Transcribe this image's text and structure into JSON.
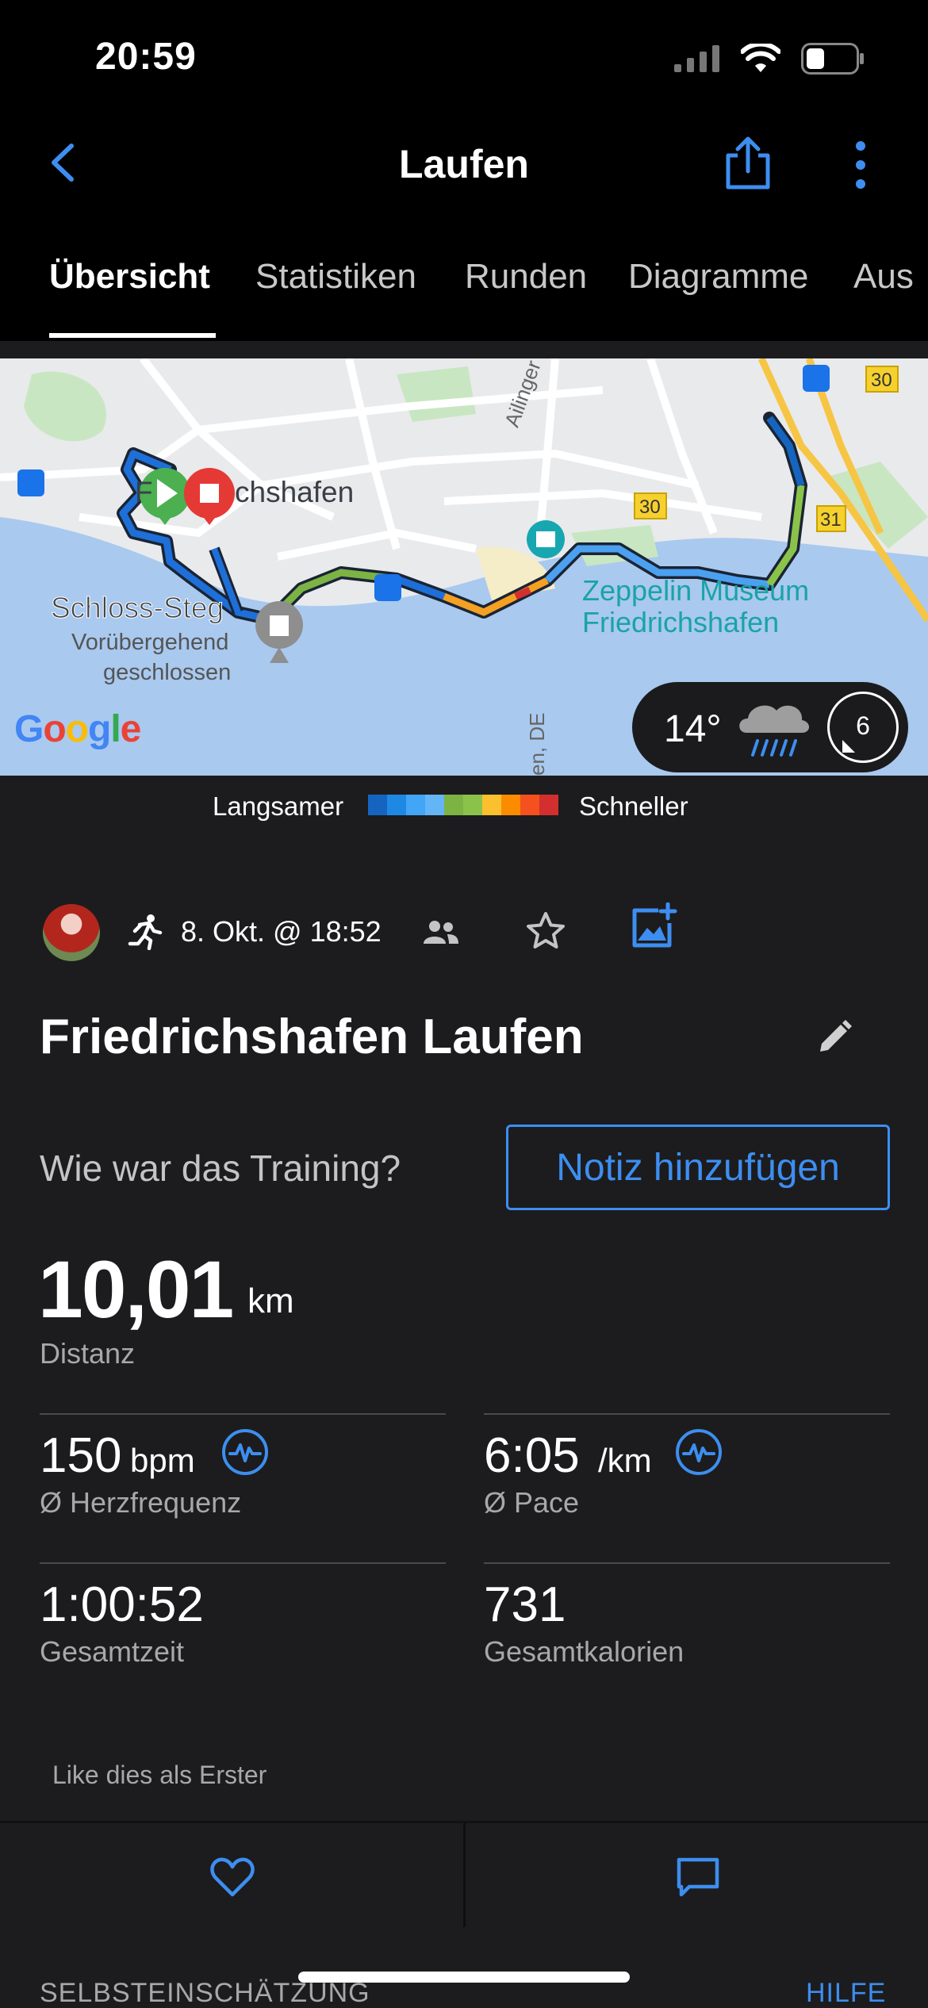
{
  "status_bar": {
    "time": "20:59"
  },
  "header": {
    "title": "Laufen"
  },
  "tabs": [
    {
      "label": "Übersicht",
      "active": true
    },
    {
      "label": "Statistiken",
      "active": false
    },
    {
      "label": "Runden",
      "active": false
    },
    {
      "label": "Diagramme",
      "active": false
    },
    {
      "label": "Aus",
      "active": false
    }
  ],
  "map": {
    "labels": {
      "city": "Friedrichshafen",
      "city_visible": "chshafen",
      "city_prefix": "F",
      "schloss": "Schloss-Steg",
      "closed_1": "Vorübergehend",
      "closed_2": "geschlossen",
      "museum_1": "Zeppelin Museum",
      "museum_2": "Friedrichshafen",
      "street": "Ailinger Str.",
      "road_30a": "30",
      "road_30b": "30",
      "road_31": "31",
      "de_label": "en, DE"
    },
    "google_logo": "Google",
    "weather": {
      "temperature": "14°",
      "wind": "6",
      "icon": "rain-cloud-icon"
    }
  },
  "legend": {
    "slow_label": "Langsamer",
    "fast_label": "Schneller",
    "colors": [
      "#1565c0",
      "#1e88e5",
      "#42a5f5",
      "#64b5f6",
      "#7cb342",
      "#8bc34a",
      "#fbc02d",
      "#fb8c00",
      "#f4511e",
      "#d32f2f"
    ]
  },
  "activity": {
    "date": "8. Okt. @ 18:52",
    "title": "Friedrichshafen Laufen",
    "question": "Wie war das Training?",
    "note_button": "Notiz hinzufügen",
    "distance": {
      "value": "10,01",
      "unit": "km",
      "label": "Distanz"
    },
    "heart_rate": {
      "value": "150",
      "unit": "bpm",
      "label": "Ø Herzfrequenz"
    },
    "pace": {
      "value": "6:05",
      "unit": "/km",
      "label": "Ø Pace"
    },
    "total_time": {
      "value": "1:00:52",
      "label": "Gesamtzeit"
    },
    "calories": {
      "value": "731",
      "label": "Gesamtkalorien"
    },
    "like_text": "Like dies als Erster"
  },
  "footer": {
    "self_assessment": "SELBSTEINSCHÄTZUNG",
    "help": "HILFE"
  },
  "colors": {
    "accent": "#3d8ef0",
    "background": "#1c1c1e"
  }
}
